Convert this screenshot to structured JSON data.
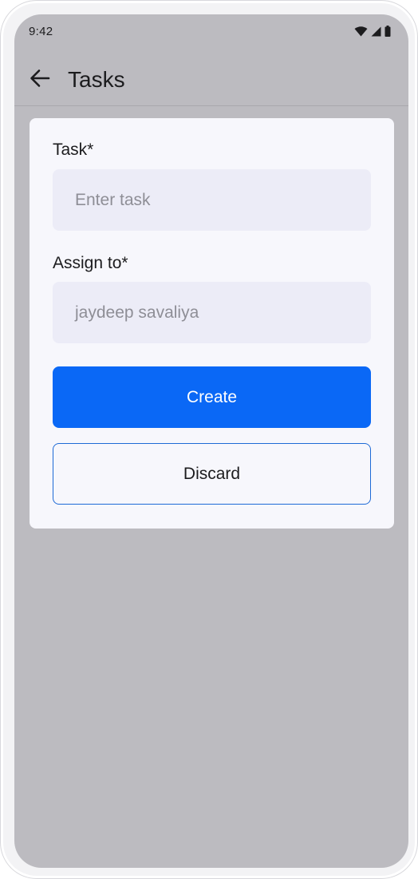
{
  "status_bar": {
    "time": "9:42",
    "icons": [
      "wifi-icon",
      "signal-icon",
      "battery-icon"
    ]
  },
  "app_bar": {
    "back_icon": "arrow-left-icon",
    "title": "Tasks"
  },
  "form": {
    "task_label": "Task*",
    "task_placeholder": "Enter task",
    "assign_label": "Assign to*",
    "assign_value": "jaydeep savaliya",
    "create_label": "Create",
    "discard_label": "Discard"
  },
  "colors": {
    "backdrop": "#bcbbc0",
    "card": "#f7f7fc",
    "input_bg": "#ececf7",
    "primary": "#0a68f6",
    "secondary_border": "#1e6ad6"
  }
}
